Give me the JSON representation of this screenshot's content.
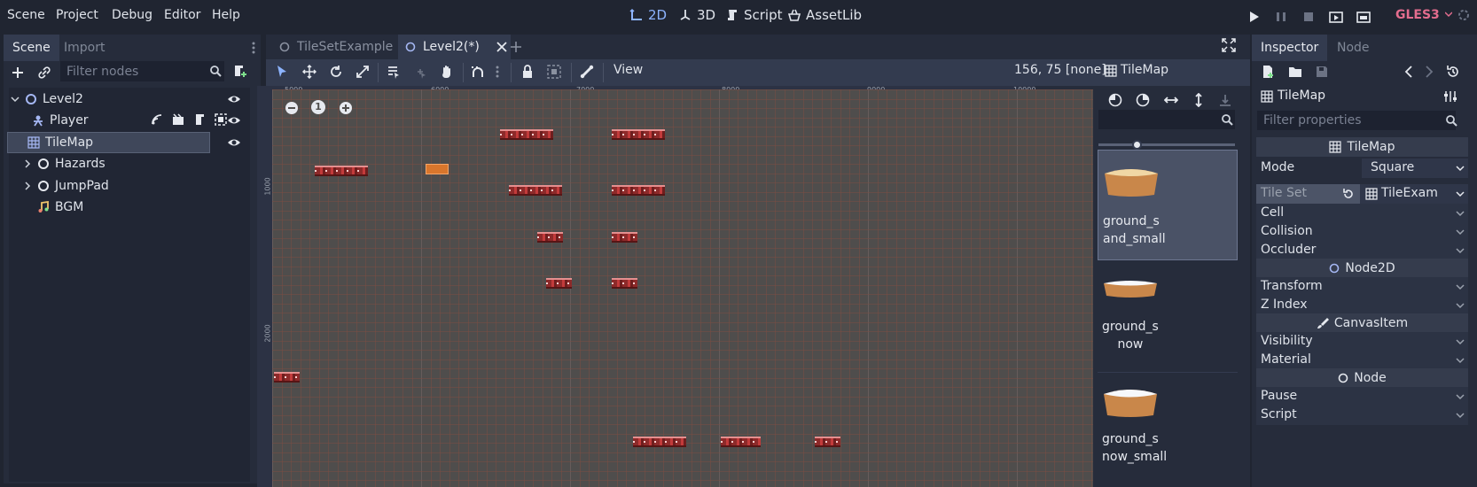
{
  "menu": [
    "Scene",
    "Project",
    "Debug",
    "Editor",
    "Help"
  ],
  "workspaces": [
    {
      "label": "2D",
      "active": true
    },
    {
      "label": "3D",
      "active": false
    },
    {
      "label": "Script",
      "active": false
    },
    {
      "label": "AssetLib",
      "active": false
    }
  ],
  "renderer": "GLES3",
  "left_dock": {
    "tabs": [
      "Scene",
      "Import"
    ],
    "filter_placeholder": "Filter nodes",
    "tree": [
      {
        "label": "Level2",
        "icon": "node2d-circle-icon"
      },
      {
        "label": "Player",
        "icon": "kinematic-body-icon"
      },
      {
        "label": "TileMap",
        "icon": "tilemap-grid-icon",
        "selected": true
      },
      {
        "label": "Hazards",
        "icon": "node2d-circle-icon"
      },
      {
        "label": "JumpPad",
        "icon": "node2d-circle-icon"
      },
      {
        "label": "BGM",
        "icon": "audio-note-icon"
      }
    ]
  },
  "editor_tabs": [
    {
      "label": "TileSetExample",
      "active": false
    },
    {
      "label": "Level2(*)",
      "active": true
    }
  ],
  "toolbar": {
    "view_label": "View",
    "status": "156, 75 [none]",
    "node_type": "TileMap"
  },
  "ruler": {
    "x_ticks": [
      "5000",
      "6000",
      "7000",
      "8000",
      "9000",
      "10000"
    ],
    "y_ticks": [
      "1000",
      "2000"
    ]
  },
  "zoom_label": "1",
  "palette": {
    "filter_placeholder": "",
    "tiles": [
      "ground_s\nand_small",
      "ground_s\nnow",
      "ground_s\nnow_small"
    ]
  },
  "inspector": {
    "tabs": [
      "Inspector",
      "Node"
    ],
    "object": "TileMap",
    "filter_placeholder": "Filter properties",
    "class_header": "TileMap",
    "mode_label": "Mode",
    "mode_value": "Square",
    "tileset_label": "Tile Set",
    "tileset_value": "TileExam",
    "groups1": [
      "Cell",
      "Collision",
      "Occluder"
    ],
    "section_node2d": "Node2D",
    "groups2": [
      "Transform",
      "Z Index"
    ],
    "section_canvas": "CanvasItem",
    "groups3": [
      "Visibility",
      "Material"
    ],
    "section_node": "Node",
    "groups4": [
      "Pause",
      "Script"
    ]
  },
  "colors": {
    "accent": "#8db4ff",
    "gles": "#e36d8e",
    "hazard_tile": "#c33b3b",
    "jumppad_tile": "#d9762c"
  }
}
